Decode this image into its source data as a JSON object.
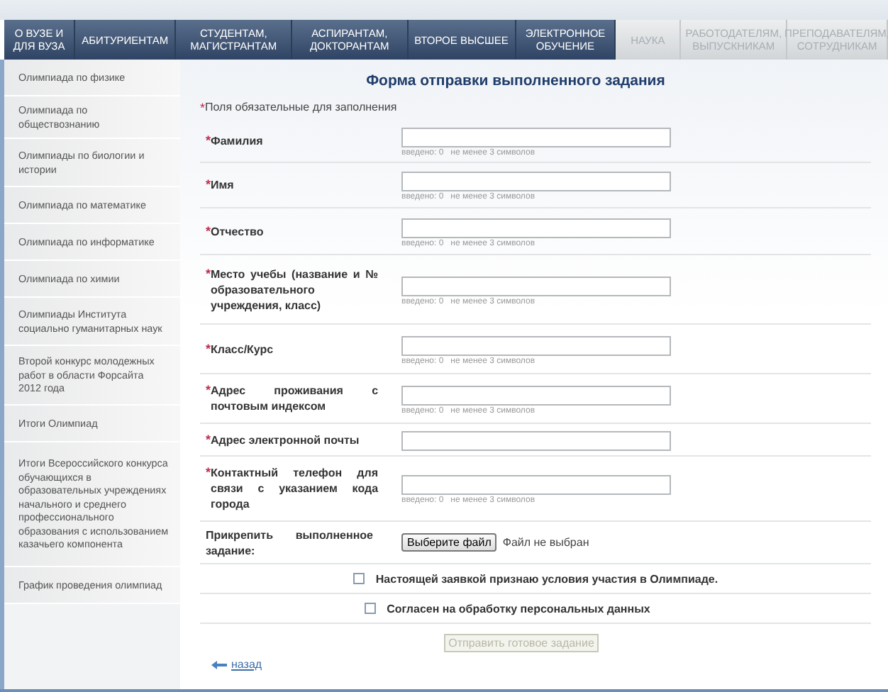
{
  "nav": [
    {
      "label": "О ВУЗЕ И ДЛЯ ВУЗА",
      "kind": "main"
    },
    {
      "label": "АБИТУРИЕНТАМ",
      "kind": "main"
    },
    {
      "label": "СТУДЕНТАМ, МАГИСТРАНТАМ",
      "kind": "main"
    },
    {
      "label": "АСПИРАНТАМ, ДОКТОРАНТАМ",
      "kind": "main"
    },
    {
      "label": "ВТОРОЕ ВЫСШЕЕ",
      "kind": "main"
    },
    {
      "label": "ЭЛЕКТРОННОЕ ОБУЧЕНИЕ",
      "kind": "main"
    },
    {
      "label": "НАУКА",
      "kind": "extra"
    },
    {
      "label": "РАБОТОДАТЕЛЯМ, ВЫПУСКНИКАМ",
      "kind": "extra"
    },
    {
      "label": "ПРЕПОДАВАТЕЛЯМ, СОТРУДНИКАМ",
      "kind": "extra"
    }
  ],
  "sidebar": {
    "items": [
      "Олимпиада по физике",
      "Олимпиада по обществознанию",
      "Олимпиады по биологии и истории",
      "Олимпиада по математике",
      "Олимпиада по информатике",
      "Олимпиада по химии",
      "Олимпиады Института социально гуманитарных наук",
      "Второй конкурс молодежных работ в области Форсайта 2012 года",
      "Итоги Олимпиад",
      "Итоги Всероссийского конкурса обучающихся в образовательных учреждениях начального и среднего профессионального образования с использованием казачьего компонента",
      "График проведения олимпиад"
    ]
  },
  "form": {
    "title": "Форма отправки выполненного задания",
    "required_note": "Поля обязательные для заполнения",
    "required_mark": "*",
    "rows": [
      {
        "kind": "text",
        "label": "Фамилия",
        "required": true,
        "hint": "введено: 0   не менее 3 символов"
      },
      {
        "kind": "text",
        "label": "Имя",
        "required": true,
        "hint": "введено: 0   не менее 3 символов"
      },
      {
        "kind": "text",
        "label": "Отчество",
        "required": true,
        "hint": "введено: 0   не менее 3 символов"
      },
      {
        "kind": "text",
        "label": "Место учебы (название и № образовательного учреждения, класс)",
        "required": true,
        "hint": "введено: 0   не менее 3 символов"
      },
      {
        "kind": "text",
        "label": "Класс/Курс",
        "required": true,
        "hint": "введено: 0   не менее 3 символов"
      },
      {
        "kind": "text",
        "label": "Адрес проживания с почтовым индексом",
        "required": true,
        "hint": "введено: 0   не менее 3 символов"
      },
      {
        "kind": "text",
        "label": "Адрес электронной почты",
        "required": true
      },
      {
        "kind": "text",
        "label": "Контактный телефон для связи с указанием кода города",
        "required": true,
        "hint": "введено: 0   не менее 3 символов"
      },
      {
        "kind": "file",
        "label": "Прикрепить выполненное задание:",
        "required": false,
        "button": "Выберите файл",
        "status": "Файл не выбран"
      }
    ],
    "checkboxes": [
      {
        "label": "Настоящей заявкой признаю условия участия в Олимпиаде.",
        "checked": false
      },
      {
        "label": "Согласен на обработку персональных данных",
        "checked": false
      }
    ],
    "submit": {
      "label": "Отправить готовое задание",
      "disabled": true
    },
    "back": "назад"
  }
}
